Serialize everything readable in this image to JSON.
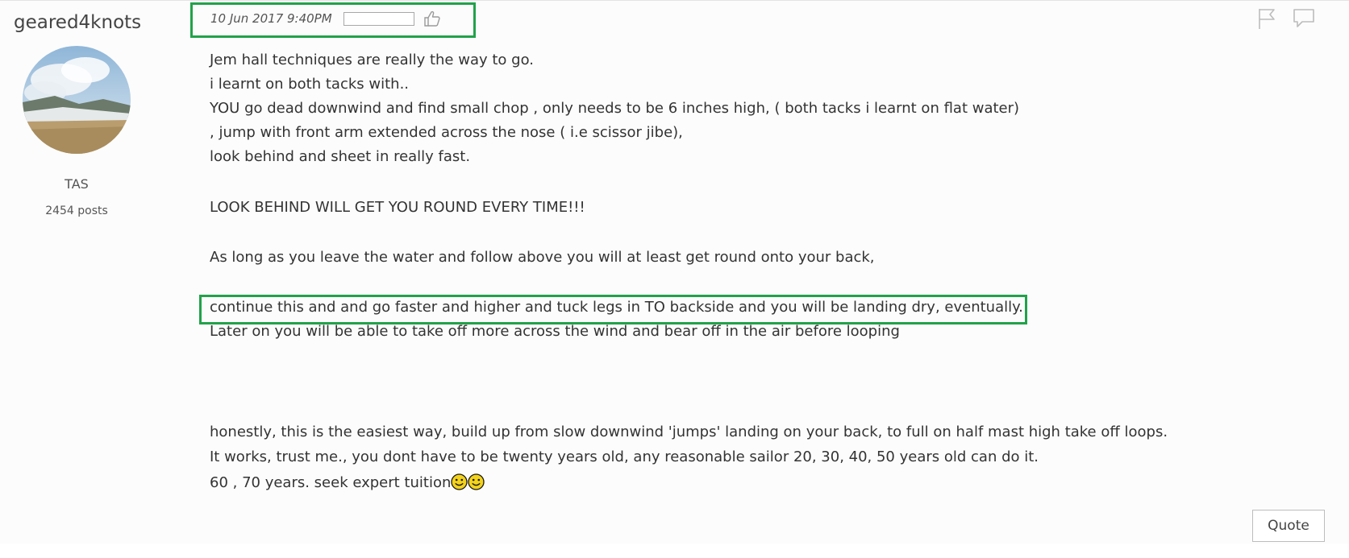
{
  "author": {
    "name": "geared4knots",
    "location": "TAS",
    "posts": "2454 posts"
  },
  "post": {
    "date": "10 Jun 2017 9:40PM",
    "lines": [
      "Jem hall techniques are really the way to go.",
      "i learnt on both tacks with..",
      "YOU go dead downwind and find small chop , only needs to be 6 inches high, ( both tacks i learnt on flat water)",
      ", jump with front arm extended across the nose ( i.e scissor jibe),",
      "look behind and sheet in really fast.",
      "LOOK BEHIND WILL GET YOU ROUND EVERY TIME!!!",
      "As long as you leave the water and follow above you will at least get round onto your back,",
      "continue this and and go faster and higher and tuck legs in TO backside and you will be landing dry, eventually.",
      "Later on you will be able to take off more across the wind and bear off in the air before looping",
      "honestly, this is the easiest way, build up from slow downwind 'jumps' landing on your back, to full on half mast high take off loops.",
      "It works, trust me., you dont have to be twenty years old, any reasonable sailor 20, 30, 40, 50 years old can do it.",
      "60 , 70 years. seek expert tuition"
    ]
  },
  "actions": {
    "quote_label": "Quote"
  },
  "icons": {
    "like": "thumbs-up-icon",
    "flag": "flag-icon",
    "comment": "comment-icon",
    "smiley": "smiley-icon"
  },
  "colors": {
    "highlight": "#22a24a",
    "smiley_fill": "#f3d21a"
  }
}
